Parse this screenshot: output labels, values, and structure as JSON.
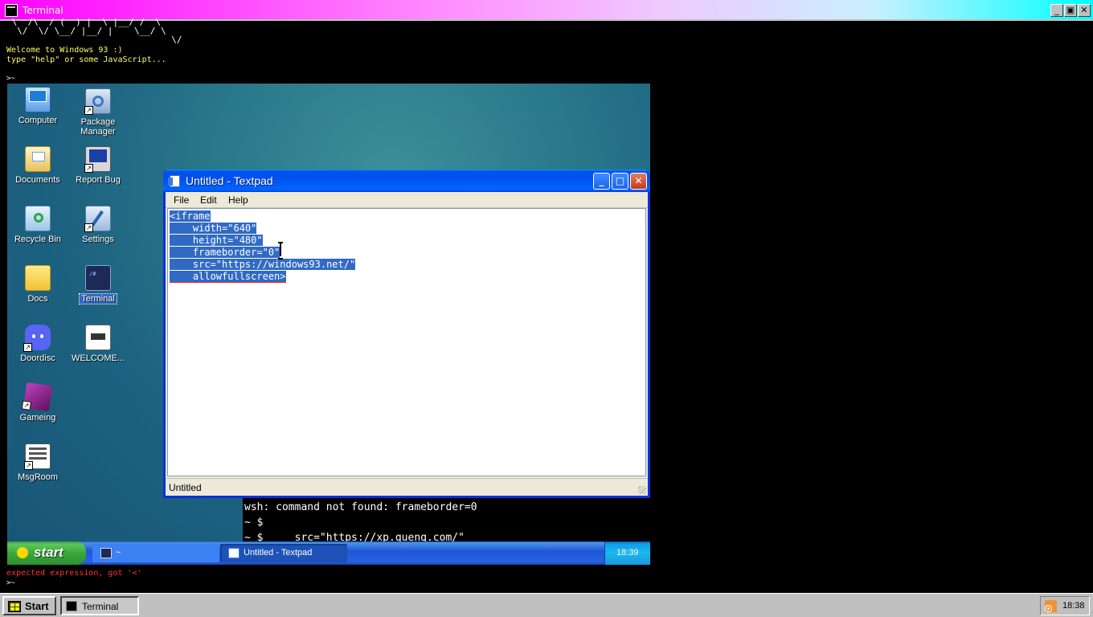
{
  "outer_window": {
    "title": "Terminal",
    "buttons": {
      "minimize": "_",
      "restore": "▣",
      "close": "✕"
    }
  },
  "terminal": {
    "ascii_art": " \\  /\\  / (  ) |  \\ |__/ /  \\ \n  \\/  \\/ \\__/ |__/ |    \\__/ \\\n                               \\/",
    "welcome_line1": "Welcome to Windows 93 :)",
    "welcome_line2": "type \"help\" or some JavaScript...",
    "prompt1": ">~",
    "error": "expected expression, got '<'",
    "prompt2": ">~"
  },
  "desktop": {
    "icons": [
      {
        "label": "Computer"
      },
      {
        "label": "Package Manager"
      },
      {
        "label": "Documents"
      },
      {
        "label": "Report Bug"
      },
      {
        "label": "Recycle Bin"
      },
      {
        "label": "Settings"
      },
      {
        "label": "Docs"
      },
      {
        "label": "Terminal"
      },
      {
        "label": "Doordisc"
      },
      {
        "label": "WELCOME..."
      },
      {
        "label": "Gameing"
      },
      {
        "label": "MsgRoom"
      }
    ]
  },
  "textpad": {
    "title": "Untitled - Textpad",
    "menu": [
      "File",
      "Edit",
      "Help"
    ],
    "code_lines": [
      "<iframe",
      "    width=\"640\"",
      "    height=\"480\"",
      "    frameborder=\"0\"",
      "    src=\"https://windows93.net/\"",
      "    allowfullscreen>"
    ],
    "status": "Untitled"
  },
  "inner_terminal": {
    "line1": "wsh: command not found: frameborder=0",
    "line2": "~ $",
    "line3": "~ $     src=\"https://xp.quenq.com/\""
  },
  "xp_taskbar": {
    "start_label": "start",
    "tasks": [
      {
        "label": "~"
      },
      {
        "label": "Untitled - Textpad"
      }
    ],
    "clock": "18:39"
  },
  "w93_taskbar": {
    "start_label": "Start",
    "task_label": "Terminal",
    "clock": "18:38"
  },
  "colors": {
    "xp_blue": "#0053ee",
    "selection": "#316ac5",
    "terminal_yellow": "#ffff66",
    "error_red": "#ff3333"
  }
}
